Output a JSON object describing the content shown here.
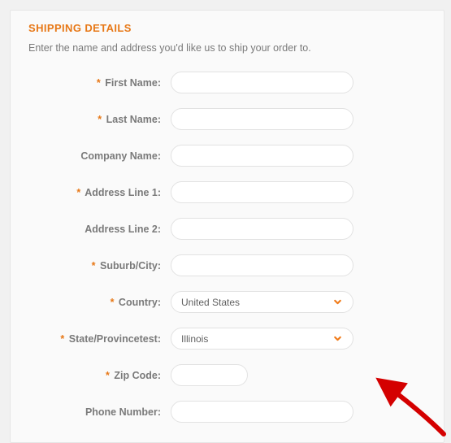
{
  "title": "SHIPPING DETAILS",
  "description": "Enter the name and address you'd like us to ship your order to.",
  "fields": {
    "first_name": {
      "label": "First Name:",
      "required": true,
      "value": ""
    },
    "last_name": {
      "label": "Last Name:",
      "required": true,
      "value": ""
    },
    "company": {
      "label": "Company Name:",
      "required": false,
      "value": ""
    },
    "address1": {
      "label": "Address Line 1:",
      "required": true,
      "value": ""
    },
    "address2": {
      "label": "Address Line 2:",
      "required": false,
      "value": ""
    },
    "city": {
      "label": "Suburb/City:",
      "required": true,
      "value": ""
    },
    "country": {
      "label": "Country:",
      "required": true,
      "selected": "United States"
    },
    "state": {
      "label": "State/Provincetest:",
      "required": true,
      "selected": "Illinois"
    },
    "zip": {
      "label": "Zip Code:",
      "required": true,
      "value": ""
    },
    "phone": {
      "label": "Phone Number:",
      "required": false,
      "value": ""
    }
  },
  "required_marker": "*"
}
